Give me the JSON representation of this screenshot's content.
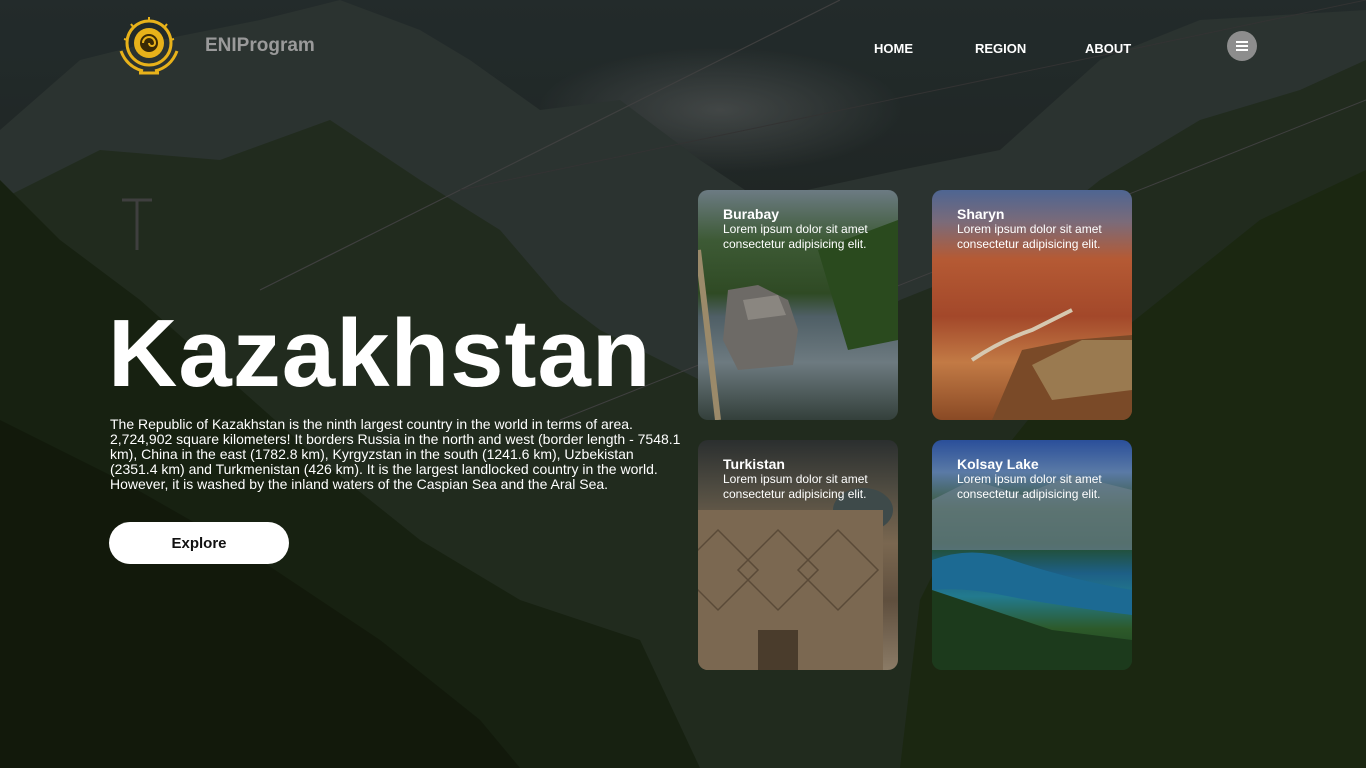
{
  "brand": {
    "name": "ENIProgram",
    "logo_icon": "kazakhstan-emblem-icon",
    "logo_color": "#e8b21a"
  },
  "nav": {
    "items": [
      "HOME",
      "REGION",
      "ABOUT"
    ],
    "menu_icon": "hamburger-menu-icon"
  },
  "hero": {
    "title": "Kazakhstan",
    "description": "The Republic of Kazakhstan is the ninth largest country in the world in terms of area. 2,724,902 square kilometers! It borders Russia in the north and west (border length - 7548.1 km), China in the east (1782.8 km), Kyrgyzstan in the south (1241.6 km), Uzbekistan (2351.4 km) and Turkmenistan (426 km). It is the largest landlocked country in the world. However, it is washed by the inland waters of the Caspian Sea and the Aral Sea.",
    "button_label": "Explore"
  },
  "cards": [
    {
      "title": "Burabay",
      "description": "Lorem ipsum dolor sit amet consectetur adipisicing elit."
    },
    {
      "title": "Sharyn",
      "description": "Lorem ipsum dolor sit amet consectetur adipisicing elit."
    },
    {
      "title": "Turkistan",
      "description": "Lorem ipsum dolor sit amet consectetur adipisicing elit."
    },
    {
      "title": "Kolsay Lake",
      "description": "Lorem ipsum dolor sit amet consectetur adipisicing elit."
    }
  ]
}
